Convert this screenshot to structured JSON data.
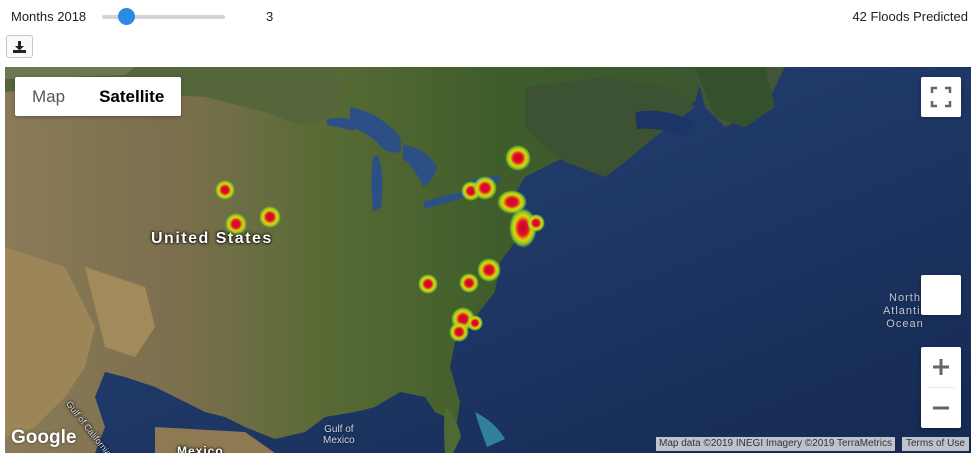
{
  "slider": {
    "label": "Months 2018",
    "value": "3",
    "fraction": 0.15
  },
  "status": {
    "floods_predicted": "42 Floods Predicted"
  },
  "toolbar": {
    "download_icon": "download-icon"
  },
  "map": {
    "type_control": {
      "map_label": "Map",
      "satellite_label": "Satellite",
      "selected": "Satellite"
    },
    "labels": {
      "country": "United States",
      "ocean_line1": "North",
      "ocean_line2": "Atlantic",
      "ocean_line3": "Ocean",
      "gulf_mexico_line1": "Gulf of",
      "gulf_mexico_line2": "Mexico",
      "gulf_california": "Gulf of California",
      "mexico": "Mexico"
    },
    "branding": "Google",
    "attribution": "Map data ©2019 INEGI Imagery ©2019 TerraMetrics",
    "terms": "Terms of Use",
    "controls": {
      "fullscreen_icon": "fullscreen-icon",
      "zoom_in": "+",
      "zoom_out": "−"
    },
    "heatmap_colors": {
      "low": "#7ed321",
      "high": "#d0021b"
    }
  }
}
